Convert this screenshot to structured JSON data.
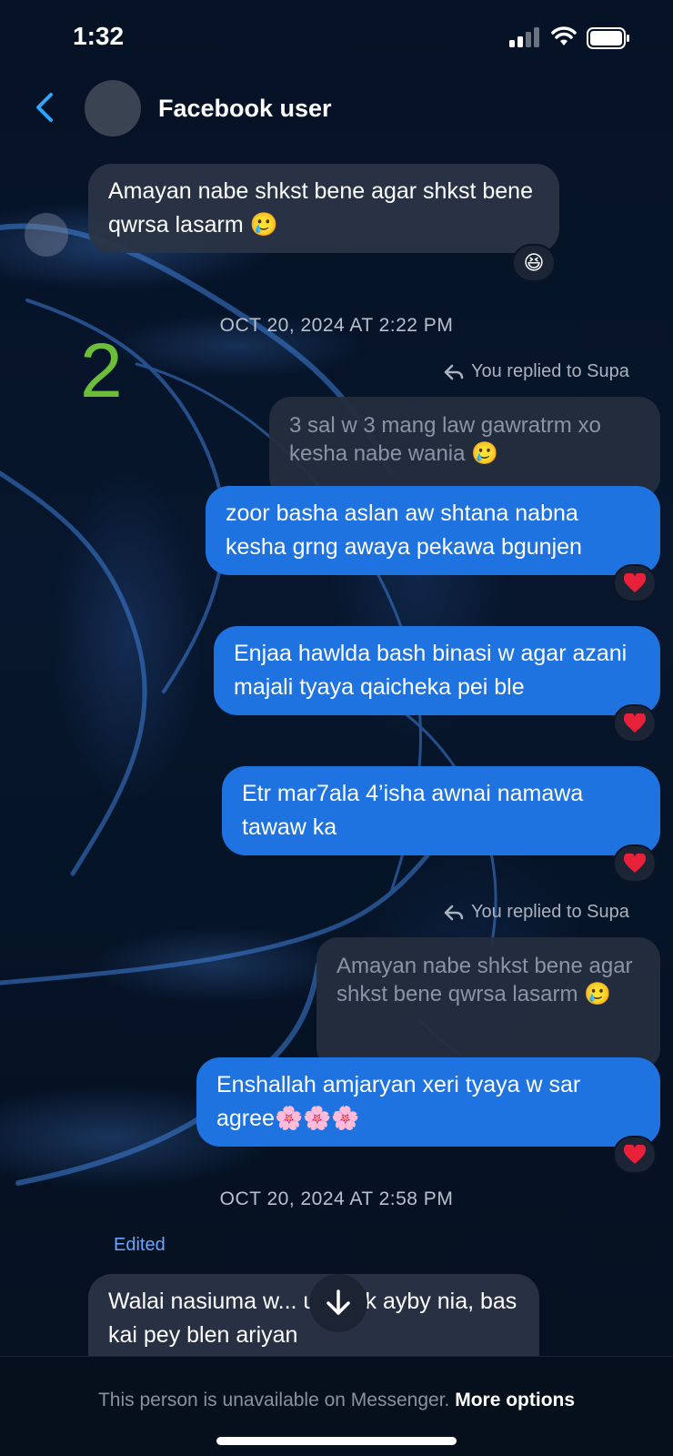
{
  "status_bar": {
    "time": "1:32"
  },
  "header": {
    "title": "Facebook user"
  },
  "messages": {
    "m1": {
      "text": "Amayan nabe shkst bene agar shkst bene qwrsa lasarm 🥲",
      "reaction": "😆"
    },
    "ts1": "OCT 20, 2024 AT 2:22 PM",
    "marker": "2",
    "reply1": {
      "label": "You replied to Supa",
      "quote": "3 sal w 3 mang law gawratrm xo kesha nabe wania 🥲"
    },
    "m2": {
      "text": "zoor basha aslan aw shtana nabna kesha grng awaya pekawa bgunjen",
      "reaction": "heart"
    },
    "m3": {
      "text": "Enjaa hawlda bash binasi w agar azani majali tyaya qaicheka pei ble",
      "reaction": "heart"
    },
    "m4": {
      "text": "Etr mar7ala 4’isha awnai namawa tawaw ka",
      "reaction": "heart"
    },
    "reply2": {
      "label": "You replied to Supa",
      "quote": "Amayan nabe shkst bene agar shkst bene qwrsa lasarm 🥲"
    },
    "m5": {
      "text": "Enshallah amjaryan xeri tyaya w sar agree🌸🌸🌸",
      "reaction": "heart"
    },
    "ts2": "OCT 20, 2024 AT 2:58 PM",
    "edited": "Edited",
    "m6": {
      "text": "Walai nasiuma w... u shtek ayby nia, bas kai pey blen ariyan"
    }
  },
  "footer": {
    "text": "This person is unavailable on Messenger.",
    "link": "More options"
  },
  "colors": {
    "accent": "#1e73e0",
    "back": "#2fa6ff",
    "heart": "#e8203a",
    "marker": "#6cbe3a"
  }
}
